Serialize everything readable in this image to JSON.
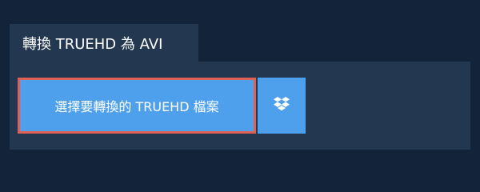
{
  "tab": {
    "title": "轉換 TRUEHD 為 AVI"
  },
  "upload": {
    "choose_label": "選擇要轉換的 TRUEHD 檔案",
    "dropbox_icon": "dropbox-icon"
  },
  "colors": {
    "background": "#13243a",
    "panel": "#233750",
    "button": "#4fa0ec",
    "highlight_border": "#e06055"
  }
}
